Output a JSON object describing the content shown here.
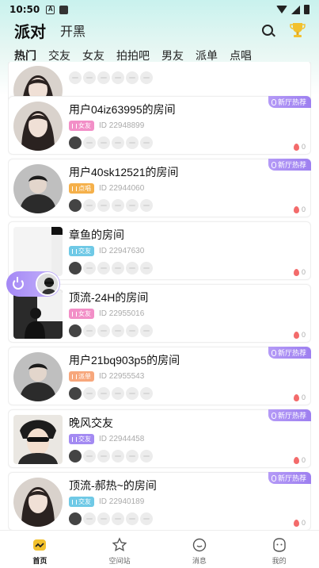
{
  "status": {
    "time": "10:50"
  },
  "header": {
    "title": "派对",
    "secondary": "开黑"
  },
  "categories": [
    "热门",
    "交友",
    "女友",
    "拍拍吧",
    "男友",
    "派单",
    "点唱"
  ],
  "cards": [
    {
      "title": "",
      "tag": "",
      "tag_color": "",
      "id": "",
      "heat": "0",
      "hot_label": "",
      "avatar": "girl-photo",
      "square": false
    },
    {
      "title": "用户04iz63995的房间",
      "tag": "女友",
      "tag_color": "#f28fc7",
      "id": "ID 22948899",
      "heat": "0",
      "hot_label": "新厅热荐",
      "avatar": "girl-photo",
      "square": false
    },
    {
      "title": "用户40sk12521的房间",
      "tag": "点唱",
      "tag_color": "#f5b04a",
      "id": "ID 22944060",
      "heat": "0",
      "hot_label": "新厅热荐",
      "avatar": "boy-photo",
      "square": false
    },
    {
      "title": "章鱼的房间",
      "tag": "交友",
      "tag_color": "#6fc9e6",
      "id": "ID 22947630",
      "heat": "0",
      "hot_label": "",
      "avatar": "grey-square",
      "square": true
    },
    {
      "title": "顶流-24H的房间",
      "tag": "女友",
      "tag_color": "#f28fc7",
      "id": "ID 22955016",
      "heat": "0",
      "hot_label": "",
      "avatar": "dark-square",
      "square": true
    },
    {
      "title": "用户21bq903p5的房间",
      "tag": "派单",
      "tag_color": "#f7a77c",
      "id": "ID 22955543",
      "heat": "0",
      "hot_label": "新厅热荐",
      "avatar": "boy-photo",
      "square": false
    },
    {
      "title": "晚风交友",
      "tag": "交友",
      "tag_color": "#a38af2",
      "id": "ID 22944458",
      "heat": "0",
      "hot_label": "新厅热荐",
      "avatar": "anime-square",
      "square": true
    },
    {
      "title": "顶流-郝热~的房间",
      "tag": "交友",
      "tag_color": "#6fc9e6",
      "id": "ID 22940189",
      "heat": "0",
      "hot_label": "新厅热荐",
      "avatar": "girl-photo",
      "square": false
    }
  ],
  "nav": [
    {
      "label": "首页",
      "icon": "home-icon",
      "active": true
    },
    {
      "label": "空间站",
      "icon": "star-icon",
      "active": false
    },
    {
      "label": "消息",
      "icon": "message-icon",
      "active": false
    },
    {
      "label": "我的",
      "icon": "profile-icon",
      "active": false
    }
  ],
  "colors": {
    "accent": "#f0c33c",
    "hot_badge": "#9d7ff0"
  }
}
